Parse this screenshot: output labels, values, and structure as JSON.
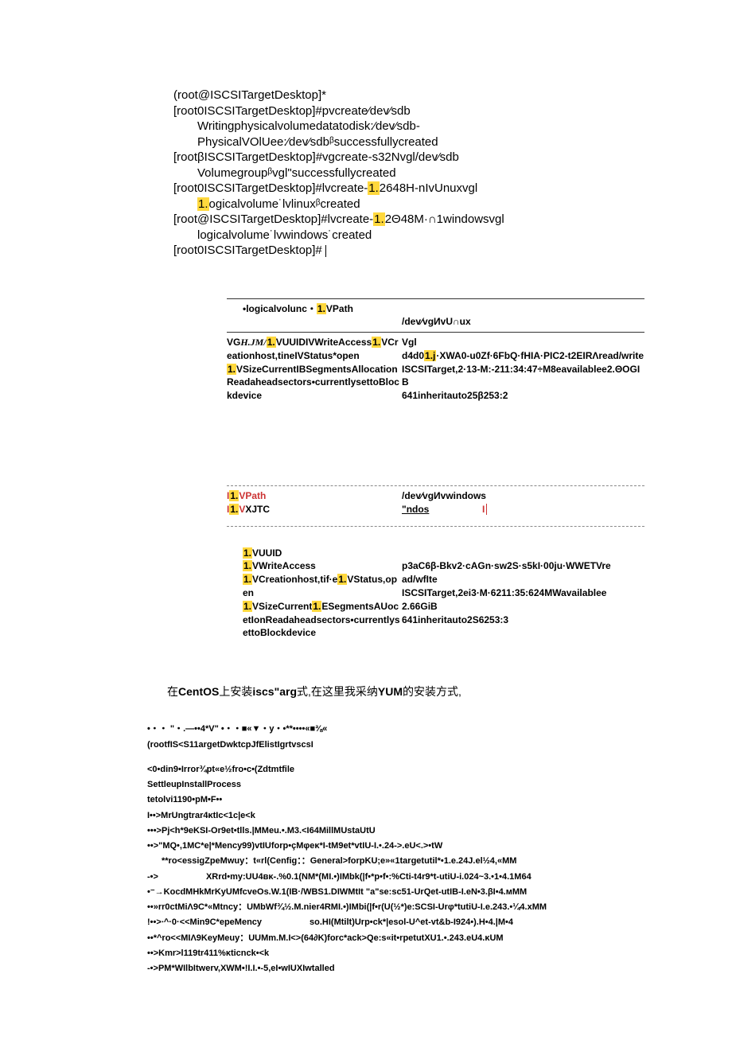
{
  "terminal": {
    "l1": "(root@ISCSITargetDesktop]*",
    "l2a": "[root0ISCSITargetDesktop]#pvcreate⁄dev⁄sdb",
    "l3": "Writingphysicalvolumedatatodisk:⁄dev⁄sdb-",
    "l4a": "PhysicalVOlUee:⁄dev⁄sdb",
    "l4b": "ᵝsuccessfullycreated",
    "l5": "[rootβISCSITargetDesktop]#vgcreate-s32Nvgl/dev⁄sdb",
    "l6a": "Volumegroup",
    "l6b": "ᵝvgl\"successfullycreated",
    "l7a": "[root0ISCSITargetDesktop]#lvcreate-",
    "l7b": "1.",
    "l7c": "2648H-nIvUnuxvgl",
    "l8a": "1.",
    "l8b": "ogicalvolume˙lvlinuxᵝcreated",
    "l9a": "[root@ISCSITargetDesktop]#lvcreate-",
    "l9b": "1.",
    "l9c": "2Θ48M·∩1windowsvgl",
    "l10": "logicalvolume˙lvwindows˙created",
    "l11": "[root0ISCSITargetDesktop]#"
  },
  "table1": {
    "r1l_a": "•logicalvolunc・",
    "r1l_b": "1.",
    "r1l_c": "VPath",
    "r1r": "/dev⁄vgИvU∩ux",
    "r2l_a": "VG",
    "r2l_b": "H.JM/",
    "r2l_c": "1.",
    "r2l_d": "VUUIDIVWriteAccess",
    "r2l_e": "1.",
    "r2l_f": "VCreationhost,tineIVStatus*open",
    "r2r_a": "Vgl",
    "r2r_b": "d4d0",
    "r2r_c": "1.j",
    "r2r_d": "·XWA0-u0Zf·6FbQ·fHIA·PIC2-t2EIRΛread/write",
    "r3l_a": "1.",
    "r3l_b": "VSizeCurrentIBSegmentsAllocationReadaheadsectors•currentlysettoBlockdevice",
    "r3r": "ISCSITarget,2·13-M:-211:34:47÷M8eavailablee2.ΘOGIB",
    "r3r2": "641inheritauto25β253:2"
  },
  "table2": {
    "r1l_a": "I",
    "r1l_b": "1.",
    "r1l_c": "VPath",
    "r1r": "/dev⁄vgИvwindows",
    "r2l_a": "I",
    "r2l_b": "1.",
    "r2l_c": "V",
    "r2l_d": "XJTC",
    "r2r": "\"ndos"
  },
  "info": {
    "l1_a": "1.",
    "l1_b": "VUUID",
    "l2_a": "1.",
    "l2_b": "VWriteAccess",
    "l3_a": "1.",
    "l3_b": "VCreationhost,tif·e",
    "l3_c": "1.",
    "l3_d": "VStatus,open",
    "l4_a": "1.",
    "l4_b": "VSizeCurrent",
    "l4_c": "1.",
    "l4_d": "ESegmentsAUocetIonReadaheadsectors•currentlysettoBlockdevice",
    "r1": "p3aC6β-Bkv2·cAGn·sw2S·s5kI·00ju·WWETVread/wfIte",
    "r2": "ISCSITarget,2ei3·M·6211:35:624MWavailablee",
    "r3": "2.66GiB",
    "r4": "641inheritauto2S6253:3"
  },
  "chinese": {
    "prefix": "在",
    "b1": "CentOS",
    "mid1": "上安装",
    "b2": "iscs\"arg",
    "mid2": "式,在这里我采纳",
    "b3": "YUM",
    "suffix": "的安装方式,"
  },
  "garbled": {
    "g1": "•・・ \"・.—••4*V\" •・・■«▼・y・•**••••«■⅜«",
    "g2": "(rootfIS<S11argetDwktcpJfElistIgrtvscsI",
    "g3": "<0•din9•Irror¾pt«e½fro•c•(Zdtmtfile",
    "g4": "SettleupInstallProcess",
    "g5": "tetolvi1190•pM•F••",
    "g6": "I••>MrUngtrar4κtIc<1c|e<k",
    "g7": "•••>Pj<h*9eKSI-Or9et•tlls.|MMeu.•.M3.<I64MillMUstaUtU",
    "g8": "••>\"MQ•,1MC*e|*Mency99)vtIUforp•çMφeκ*I-tM9et*vtIU-I.•.24->.eU<.>•tW",
    "g9": "**ro<essigZpeMwuy：t«rl(Cenfig：：General>forpKU;e»«1targetutil*•1.e.24J.el½4,«MM",
    "g10a": "-•>",
    "g10b": "XRrd•my:UU4ʙᴋ-.%0.1(NM*(MI.•)IMbk(|f•*p•f•:%Cti-t4r9*t-utiU-i.024~3.•1•4.1M64",
    "g11": "•⁻→KocdMHkMrKyUMfcveOs.W.1(IB·/WBS1.DIWMtIt \"a\"se:sc51-UrQet-utIB-I.eN•3.βI•4.ᴍMM",
    "g12": "••»rr0ctMiΛ9C*«Mtncy：UMbWf¾½.M.nier4RMI.•)IMbi(|f•r(U(½*)e:SCSI-Urφ*tutiU-I.e.243.•¼4.xMM",
    "g13a": "!••>∙^·0·<<Min9C*epeMency",
    "g13b": "so.HI(Mtilt)Urp•ck*|esol-U^et-vt&b-I924•).H•4.|M•4",
    "g14": "••*^ro<<MIΛ9KeyMeuy：UUMm.M.I<>(64∂K)forc*ack>Qe:s«it•rpetutXU1.•.243.eU4.κUM",
    "g15": "••>Kmr>l119tr411%κticnck•<k",
    "g16": "-•>PM*WIlbItwerv,XWM•!I.I.•-5,eI•wIUXIwtalled"
  }
}
